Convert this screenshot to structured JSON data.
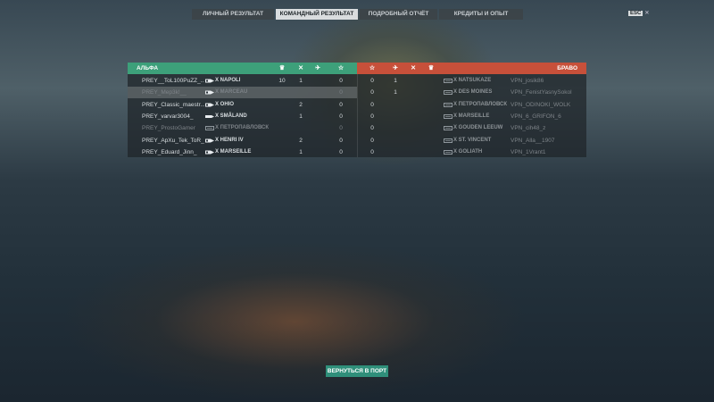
{
  "tabs": [
    {
      "label": "ЛИЧНЫЙ РЕЗУЛЬТАТ",
      "active": false
    },
    {
      "label": "КОМАНДНЫЙ РЕЗУЛЬТАТ",
      "active": true
    },
    {
      "label": "ПОДРОБНЫЙ ОТЧЁТ",
      "active": false
    },
    {
      "label": "КРЕДИТЫ И ОПЫТ",
      "active": false
    }
  ],
  "esc": {
    "key": "ESC",
    "close": "✕"
  },
  "teams": {
    "left": {
      "name": "АЛЬФА",
      "color": "#3da07a",
      "header_icons": [
        "laurel-icon",
        "crossed-swords-icon",
        "plane-icon",
        "star-icon"
      ],
      "rows": [
        {
          "player": "PREY__ToL100PuZZ_...",
          "ship_icon": "cruiser-icon",
          "ship": "X NAPOLI",
          "c1": "10",
          "c2": "1",
          "c3": "",
          "c4": "0",
          "highlight": false,
          "dim": false
        },
        {
          "player": "PREY_Mep3k!__",
          "ship_icon": "cruiser-icon",
          "ship": "X MARCEAU",
          "c1": "",
          "c2": "",
          "c3": "",
          "c4": "0",
          "highlight": true,
          "dim": true
        },
        {
          "player": "PREY_Classic_maestr...",
          "ship_icon": "cruiser-icon",
          "ship": "X OHIO",
          "c1": "",
          "c2": "2",
          "c3": "",
          "c4": "0",
          "highlight": false,
          "dim": false
        },
        {
          "player": "PREY_varvar3004_",
          "ship_icon": "destroyer-icon",
          "ship": "X SMÅLAND",
          "c1": "",
          "c2": "1",
          "c3": "",
          "c4": "0",
          "highlight": false,
          "dim": false
        },
        {
          "player": "PREY_ProstoGamer",
          "ship_icon": "carrier-icon",
          "ship": "X ПЕТРОПАВЛОВСК",
          "c1": "",
          "c2": "",
          "c3": "",
          "c4": "0",
          "highlight": false,
          "dim": true
        },
        {
          "player": "PREY_ApXu_Tek_ToR_",
          "ship_icon": "cruiser-icon",
          "ship": "X HENRI IV",
          "c1": "",
          "c2": "2",
          "c3": "",
          "c4": "0",
          "highlight": false,
          "dim": false
        },
        {
          "player": "PREY_Eduard_Jinn_",
          "ship_icon": "cruiser-icon",
          "ship": "X MARSEILLE",
          "c1": "",
          "c2": "1",
          "c3": "",
          "c4": "0",
          "highlight": false,
          "dim": false
        }
      ]
    },
    "right": {
      "name": "БРАВО",
      "color": "#c7503a",
      "header_icons": [
        "star-icon",
        "plane-icon",
        "crossed-swords-icon",
        "laurel-icon"
      ],
      "rows": [
        {
          "player": "VPN_josik86",
          "ship_icon": "carrier-icon",
          "ship": "X NATSUKAZE",
          "c1": "0",
          "c2": "1",
          "c3": "",
          "c4": ""
        },
        {
          "player": "VPN_FenistYasnySokol",
          "ship_icon": "carrier-icon",
          "ship": "X DES MOINES",
          "c1": "0",
          "c2": "1",
          "c3": "",
          "c4": ""
        },
        {
          "player": "VPN_ODINOKI_WOLK",
          "ship_icon": "carrier-icon",
          "ship": "X ПЕТРОПАВЛОВСК",
          "c1": "0",
          "c2": "",
          "c3": "",
          "c4": ""
        },
        {
          "player": "VPN_6_GRIFON_6",
          "ship_icon": "carrier-icon",
          "ship": "X MARSEILLE",
          "c1": "0",
          "c2": "",
          "c3": "",
          "c4": ""
        },
        {
          "player": "VPN_cih48_z",
          "ship_icon": "carrier-icon",
          "ship": "X GOUDEN LEEUW",
          "c1": "0",
          "c2": "",
          "c3": "",
          "c4": ""
        },
        {
          "player": "VPN_Alla__1907",
          "ship_icon": "carrier-icon",
          "ship": "X ST. VINCENT",
          "c1": "0",
          "c2": "",
          "c3": "",
          "c4": ""
        },
        {
          "player": "VPN_1Vrant1",
          "ship_icon": "carrier-icon",
          "ship": "X GOLIATH",
          "c1": "0",
          "c2": "",
          "c3": "",
          "c4": ""
        }
      ]
    }
  },
  "port_button": "ВЕРНУТЬСЯ В ПОРТ"
}
